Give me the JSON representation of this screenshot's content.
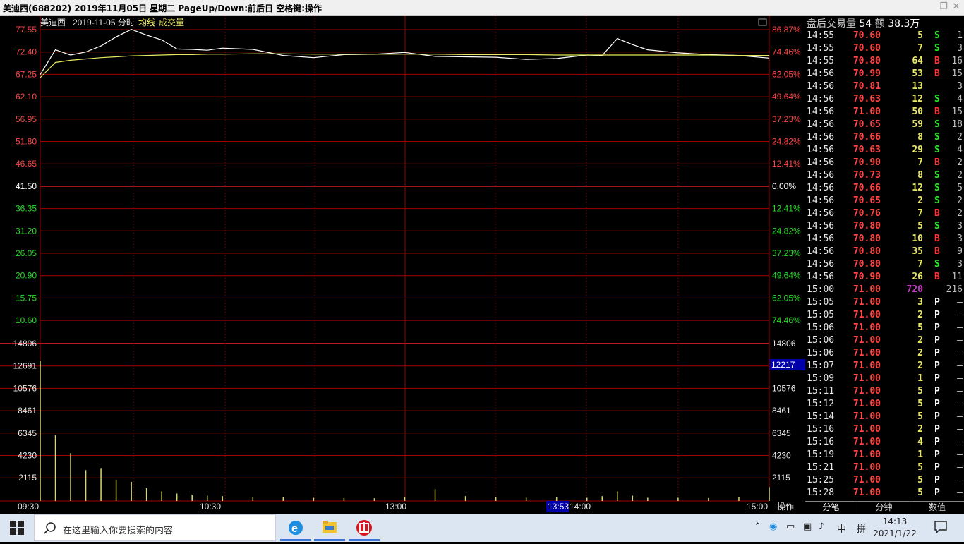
{
  "window": {
    "title": "美迪西(688202)  2019年11月05日 星期二 PageUp/Down:前后日 空格键:操作",
    "controls": [
      "restore-icon",
      "close-icon"
    ]
  },
  "chart_header": {
    "stock_name": "美迪西",
    "date_label": "2019-11-05 分时",
    "avg_label": "均线",
    "vol_label": "成交量"
  },
  "price_axis": {
    "left": [
      "77.55",
      "72.40",
      "67.25",
      "62.10",
      "56.95",
      "51.80",
      "46.65",
      "41.50",
      "36.35",
      "31.20",
      "26.05",
      "20.90",
      "15.75",
      "10.60"
    ],
    "right": [
      "86.87%",
      "74.46%",
      "62.05%",
      "49.64%",
      "37.23%",
      "24.82%",
      "12.41%",
      "0.00%",
      "12.41%",
      "24.82%",
      "37.23%",
      "49.64%",
      "62.05%",
      "74.46%"
    ]
  },
  "volume_axis": {
    "left": [
      "14806",
      "12691",
      "10576",
      "8461",
      "6345",
      "4230",
      "2115"
    ],
    "right": [
      "14806",
      "10576",
      "8461",
      "6345",
      "4230",
      "2115"
    ],
    "cursor_value": "12217"
  },
  "time_axis": {
    "labels": [
      "09:30",
      "10:30",
      "13:00",
      "14:00",
      "15:00"
    ],
    "cursor_time": "13:53",
    "ops_label": "操作"
  },
  "colors": {
    "up": "#ff4444",
    "down": "#22dd22",
    "grid": "#a00000",
    "price_line": "#ffffff",
    "avg_line": "#e8e860",
    "volume": "#d8d870",
    "buy": "#ff3333",
    "sell": "#22ee22",
    "neutral": "#ffffff",
    "big": "#cc33cc",
    "vol_text": "#e8e860"
  },
  "chart_data": [
    {
      "type": "line",
      "title": "",
      "prev_close": 41.5,
      "ylim": [
        5.45,
        77.55
      ],
      "x": [
        "09:30",
        "09:35",
        "09:40",
        "09:45",
        "09:50",
        "09:55",
        "10:00",
        "10:05",
        "10:10",
        "10:15",
        "10:20",
        "10:25",
        "10:30",
        "10:40",
        "10:50",
        "11:00",
        "11:10",
        "11:20",
        "11:30",
        "13:10",
        "13:20",
        "13:30",
        "13:40",
        "13:50",
        "14:00",
        "14:05",
        "14:10",
        "14:15",
        "14:20",
        "14:30",
        "14:40",
        "14:50",
        "15:00"
      ],
      "series": [
        {
          "values": [
            67.2,
            72.9,
            71.7,
            72.4,
            73.8,
            75.9,
            77.6,
            76.3,
            75.2,
            73.1,
            73.0,
            72.8,
            73.3,
            73.0,
            71.6,
            71.1,
            71.8,
            71.9,
            72.3,
            71.4,
            71.3,
            71.2,
            70.7,
            70.9,
            71.7,
            71.6,
            75.5,
            74.1,
            72.9,
            72.2,
            71.8,
            71.6,
            71.0
          ]
        },
        {
          "values": [
            66.5,
            70.0,
            70.5,
            70.8,
            71.1,
            71.3,
            71.5,
            71.6,
            71.7,
            71.8,
            71.8,
            71.9,
            71.9,
            72.0,
            72.0,
            71.9,
            71.9,
            71.9,
            71.9,
            71.9,
            71.8,
            71.8,
            71.8,
            71.7,
            71.7,
            71.7,
            71.7,
            71.7,
            71.7,
            71.7,
            71.7,
            71.6,
            71.6
          ]
        }
      ]
    },
    {
      "type": "bar",
      "title": "",
      "ylim": [
        0,
        14806
      ],
      "x": [
        "09:30",
        "09:35",
        "09:40",
        "09:45",
        "09:50",
        "09:55",
        "10:00",
        "10:05",
        "10:10",
        "10:15",
        "10:20",
        "10:25",
        "10:30",
        "10:40",
        "10:50",
        "11:00",
        "11:10",
        "11:20",
        "11:30",
        "13:10",
        "13:20",
        "13:30",
        "13:40",
        "13:50",
        "14:00",
        "14:05",
        "14:10",
        "14:15",
        "14:20",
        "14:30",
        "14:40",
        "14:50",
        "15:00"
      ],
      "values": [
        13200,
        6200,
        4500,
        2900,
        3100,
        2000,
        1800,
        1200,
        900,
        700,
        600,
        500,
        450,
        400,
        350,
        300,
        280,
        250,
        400,
        1100,
        450,
        350,
        300,
        350,
        300,
        450,
        900,
        500,
        300,
        300,
        280,
        350,
        1300
      ]
    }
  ],
  "tick_panel": {
    "header_label": "盘后交易量",
    "header_vol": "54",
    "header_amt_label": "额",
    "header_amt": "38.3万",
    "rows": [
      {
        "time": "14:55",
        "price": "70.60",
        "vol": "5",
        "flag": "S",
        "cnt": "1",
        "pc": "up",
        "vc": "vol",
        "fc": "sell"
      },
      {
        "time": "14:55",
        "price": "70.60",
        "vol": "7",
        "flag": "S",
        "cnt": "3",
        "pc": "up",
        "vc": "vol",
        "fc": "sell"
      },
      {
        "time": "14:55",
        "price": "70.80",
        "vol": "64",
        "flag": "B",
        "cnt": "16",
        "pc": "up",
        "vc": "vol",
        "fc": "buy"
      },
      {
        "time": "14:56",
        "price": "70.99",
        "vol": "53",
        "flag": "B",
        "cnt": "15",
        "pc": "up",
        "vc": "vol",
        "fc": "buy"
      },
      {
        "time": "14:56",
        "price": "70.81",
        "vol": "13",
        "flag": "",
        "cnt": "3",
        "pc": "up",
        "vc": "vol",
        "fc": "neutral"
      },
      {
        "time": "14:56",
        "price": "70.63",
        "vol": "12",
        "flag": "S",
        "cnt": "4",
        "pc": "up",
        "vc": "vol",
        "fc": "sell"
      },
      {
        "time": "14:56",
        "price": "71.00",
        "vol": "50",
        "flag": "B",
        "cnt": "15",
        "pc": "up",
        "vc": "vol",
        "fc": "buy"
      },
      {
        "time": "14:56",
        "price": "70.65",
        "vol": "59",
        "flag": "S",
        "cnt": "18",
        "pc": "up",
        "vc": "vol",
        "fc": "sell"
      },
      {
        "time": "14:56",
        "price": "70.66",
        "vol": "8",
        "flag": "S",
        "cnt": "2",
        "pc": "up",
        "vc": "vol",
        "fc": "sell"
      },
      {
        "time": "14:56",
        "price": "70.63",
        "vol": "29",
        "flag": "S",
        "cnt": "4",
        "pc": "up",
        "vc": "vol",
        "fc": "sell"
      },
      {
        "time": "14:56",
        "price": "70.90",
        "vol": "7",
        "flag": "B",
        "cnt": "2",
        "pc": "up",
        "vc": "vol",
        "fc": "buy"
      },
      {
        "time": "14:56",
        "price": "70.73",
        "vol": "8",
        "flag": "S",
        "cnt": "2",
        "pc": "up",
        "vc": "vol",
        "fc": "sell"
      },
      {
        "time": "14:56",
        "price": "70.66",
        "vol": "12",
        "flag": "S",
        "cnt": "5",
        "pc": "up",
        "vc": "vol",
        "fc": "sell"
      },
      {
        "time": "14:56",
        "price": "70.65",
        "vol": "2",
        "flag": "S",
        "cnt": "2",
        "pc": "up",
        "vc": "vol",
        "fc": "sell"
      },
      {
        "time": "14:56",
        "price": "70.76",
        "vol": "7",
        "flag": "B",
        "cnt": "2",
        "pc": "up",
        "vc": "vol",
        "fc": "buy"
      },
      {
        "time": "14:56",
        "price": "70.80",
        "vol": "5",
        "flag": "S",
        "cnt": "3",
        "pc": "up",
        "vc": "vol",
        "fc": "sell"
      },
      {
        "time": "14:56",
        "price": "70.80",
        "vol": "10",
        "flag": "B",
        "cnt": "3",
        "pc": "up",
        "vc": "vol",
        "fc": "buy"
      },
      {
        "time": "14:56",
        "price": "70.80",
        "vol": "35",
        "flag": "B",
        "cnt": "9",
        "pc": "up",
        "vc": "vol",
        "fc": "buy"
      },
      {
        "time": "14:56",
        "price": "70.80",
        "vol": "7",
        "flag": "S",
        "cnt": "3",
        "pc": "up",
        "vc": "vol",
        "fc": "sell"
      },
      {
        "time": "14:56",
        "price": "70.90",
        "vol": "26",
        "flag": "B",
        "cnt": "11",
        "pc": "up",
        "vc": "vol",
        "fc": "buy"
      },
      {
        "time": "15:00",
        "price": "71.00",
        "vol": "720",
        "flag": "",
        "cnt": "216",
        "pc": "up",
        "vc": "big",
        "fc": "neutral"
      },
      {
        "time": "15:05",
        "price": "71.00",
        "vol": "3",
        "flag": "P",
        "cnt": "—",
        "pc": "up",
        "vc": "vol",
        "fc": "neutral"
      },
      {
        "time": "15:05",
        "price": "71.00",
        "vol": "2",
        "flag": "P",
        "cnt": "—",
        "pc": "up",
        "vc": "vol",
        "fc": "neutral"
      },
      {
        "time": "15:06",
        "price": "71.00",
        "vol": "5",
        "flag": "P",
        "cnt": "—",
        "pc": "up",
        "vc": "vol",
        "fc": "neutral"
      },
      {
        "time": "15:06",
        "price": "71.00",
        "vol": "2",
        "flag": "P",
        "cnt": "—",
        "pc": "up",
        "vc": "vol",
        "fc": "neutral"
      },
      {
        "time": "15:06",
        "price": "71.00",
        "vol": "2",
        "flag": "P",
        "cnt": "—",
        "pc": "up",
        "vc": "vol",
        "fc": "neutral"
      },
      {
        "time": "15:07",
        "price": "71.00",
        "vol": "2",
        "flag": "P",
        "cnt": "—",
        "pc": "up",
        "vc": "vol",
        "fc": "neutral"
      },
      {
        "time": "15:09",
        "price": "71.00",
        "vol": "1",
        "flag": "P",
        "cnt": "—",
        "pc": "up",
        "vc": "vol",
        "fc": "neutral"
      },
      {
        "time": "15:11",
        "price": "71.00",
        "vol": "5",
        "flag": "P",
        "cnt": "—",
        "pc": "up",
        "vc": "vol",
        "fc": "neutral"
      },
      {
        "time": "15:12",
        "price": "71.00",
        "vol": "5",
        "flag": "P",
        "cnt": "—",
        "pc": "up",
        "vc": "vol",
        "fc": "neutral"
      },
      {
        "time": "15:14",
        "price": "71.00",
        "vol": "5",
        "flag": "P",
        "cnt": "—",
        "pc": "up",
        "vc": "vol",
        "fc": "neutral"
      },
      {
        "time": "15:16",
        "price": "71.00",
        "vol": "2",
        "flag": "P",
        "cnt": "—",
        "pc": "up",
        "vc": "vol",
        "fc": "neutral"
      },
      {
        "time": "15:16",
        "price": "71.00",
        "vol": "4",
        "flag": "P",
        "cnt": "—",
        "pc": "up",
        "vc": "vol",
        "fc": "neutral"
      },
      {
        "time": "15:19",
        "price": "71.00",
        "vol": "1",
        "flag": "P",
        "cnt": "—",
        "pc": "up",
        "vc": "vol",
        "fc": "neutral"
      },
      {
        "time": "15:21",
        "price": "71.00",
        "vol": "5",
        "flag": "P",
        "cnt": "—",
        "pc": "up",
        "vc": "vol",
        "fc": "neutral"
      },
      {
        "time": "15:25",
        "price": "71.00",
        "vol": "5",
        "flag": "P",
        "cnt": "—",
        "pc": "up",
        "vc": "vol",
        "fc": "neutral"
      },
      {
        "time": "15:28",
        "price": "71.00",
        "vol": "5",
        "flag": "P",
        "cnt": "—",
        "pc": "up",
        "vc": "vol",
        "fc": "neutral"
      }
    ],
    "tabs": [
      "分笔",
      "分钟",
      "数值"
    ]
  },
  "taskbar": {
    "search_placeholder": "在这里输入你要搜索的内容",
    "apps": [
      "ie-icon",
      "file-explorer-icon",
      "citic-securities-icon"
    ],
    "tray": {
      "ime": "中",
      "ime_mode": "拼"
    },
    "time": "14:13",
    "date": "2021/1/22"
  }
}
